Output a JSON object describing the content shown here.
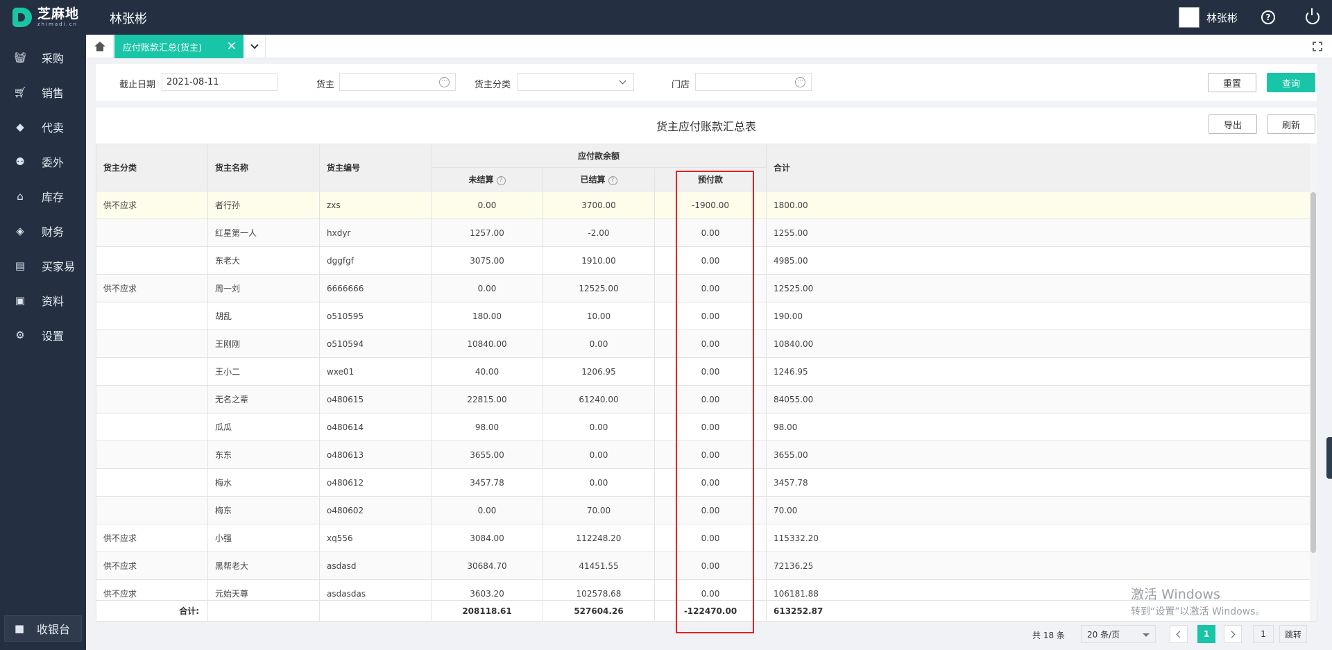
{
  "app": {
    "logo_cn": "芝麻地",
    "logo_en": "zhimadi.cn",
    "user_name": "林张彬"
  },
  "sidebar": {
    "items": [
      {
        "label": "采购",
        "icon": "basket-icon"
      },
      {
        "label": "销售",
        "icon": "cart-icon"
      },
      {
        "label": "代卖",
        "icon": "tag-icon"
      },
      {
        "label": "委外",
        "icon": "people-icon"
      },
      {
        "label": "库存",
        "icon": "warehouse-icon"
      },
      {
        "label": "财务",
        "icon": "finance-icon"
      },
      {
        "label": "买家易",
        "icon": "store-icon"
      },
      {
        "label": "资料",
        "icon": "printer-icon"
      },
      {
        "label": "设置",
        "icon": "gear-icon"
      }
    ],
    "cashier": "收银台"
  },
  "tabs": {
    "active_label": "应付账款汇总(货主)"
  },
  "filters": {
    "date_label": "截止日期",
    "date_value": "2021-08-11",
    "owner_label": "货主",
    "owner_value": "",
    "category_label": "货主分类",
    "category_value": "",
    "store_label": "门店",
    "store_value": "",
    "reset_label": "重置",
    "query_label": "查询"
  },
  "report": {
    "title": "货主应付账款汇总表",
    "export_label": "导出",
    "refresh_label": "刷新",
    "columns": {
      "category": "货主分类",
      "name": "货主名称",
      "code": "货主编号",
      "balance_group": "应付款余额",
      "unsettled": "未结算",
      "settled": "已结算",
      "prepaid": "预付款",
      "total": "合计"
    },
    "rows": [
      {
        "category": "供不应求",
        "name": "者行孙",
        "code": "zxs",
        "unsettled": "0.00",
        "settled": "3700.00",
        "prepaid": "-1900.00",
        "total": "1800.00"
      },
      {
        "category": "",
        "name": "红星第一人",
        "code": "hxdyr",
        "unsettled": "1257.00",
        "settled": "-2.00",
        "prepaid": "0.00",
        "total": "1255.00"
      },
      {
        "category": "",
        "name": "东老大",
        "code": "dggfgf",
        "unsettled": "3075.00",
        "settled": "1910.00",
        "prepaid": "0.00",
        "total": "4985.00"
      },
      {
        "category": "供不应求",
        "name": "周一刘",
        "code": "6666666",
        "unsettled": "0.00",
        "settled": "12525.00",
        "prepaid": "0.00",
        "total": "12525.00"
      },
      {
        "category": "",
        "name": "胡乱",
        "code": "o510595",
        "unsettled": "180.00",
        "settled": "10.00",
        "prepaid": "0.00",
        "total": "190.00"
      },
      {
        "category": "",
        "name": "王刚刚",
        "code": "o510594",
        "unsettled": "10840.00",
        "settled": "0.00",
        "prepaid": "0.00",
        "total": "10840.00"
      },
      {
        "category": "",
        "name": "王小二",
        "code": "wxe01",
        "unsettled": "40.00",
        "settled": "1206.95",
        "prepaid": "0.00",
        "total": "1246.95"
      },
      {
        "category": "",
        "name": "无名之辈",
        "code": "o480615",
        "unsettled": "22815.00",
        "settled": "61240.00",
        "prepaid": "0.00",
        "total": "84055.00"
      },
      {
        "category": "",
        "name": "瓜瓜",
        "code": "o480614",
        "unsettled": "98.00",
        "settled": "0.00",
        "prepaid": "0.00",
        "total": "98.00"
      },
      {
        "category": "",
        "name": "东东",
        "code": "o480613",
        "unsettled": "3655.00",
        "settled": "0.00",
        "prepaid": "0.00",
        "total": "3655.00"
      },
      {
        "category": "",
        "name": "梅水",
        "code": "o480612",
        "unsettled": "3457.78",
        "settled": "0.00",
        "prepaid": "0.00",
        "total": "3457.78"
      },
      {
        "category": "",
        "name": "梅东",
        "code": "o480602",
        "unsettled": "0.00",
        "settled": "70.00",
        "prepaid": "0.00",
        "total": "70.00"
      },
      {
        "category": "供不应求",
        "name": "小强",
        "code": "xq556",
        "unsettled": "3084.00",
        "settled": "112248.20",
        "prepaid": "0.00",
        "total": "115332.20"
      },
      {
        "category": "供不应求",
        "name": "黑帮老大",
        "code": "asdasd",
        "unsettled": "30684.70",
        "settled": "41451.55",
        "prepaid": "0.00",
        "total": "72136.25"
      },
      {
        "category": "供不应求",
        "name": "元始天尊",
        "code": "asdasdas",
        "unsettled": "3603.20",
        "settled": "102578.68",
        "prepaid": "0.00",
        "total": "106181.88"
      }
    ],
    "totals": {
      "label": "合计:",
      "unsettled": "208118.61",
      "settled": "527604.26",
      "prepaid": "-122470.00",
      "total": "613252.87"
    }
  },
  "pagination": {
    "total_text": "共 18 条",
    "page_size": "20 条/页",
    "current_page": "1",
    "jump_input": "1",
    "jump_label": "跳转"
  },
  "watermark": {
    "line1": "激活 Windows",
    "line2": "转到“设置”以激活 Windows。"
  },
  "colors": {
    "accent": "#18c5a6",
    "nav_bg": "#243042",
    "highlight_box": "#e82020"
  }
}
